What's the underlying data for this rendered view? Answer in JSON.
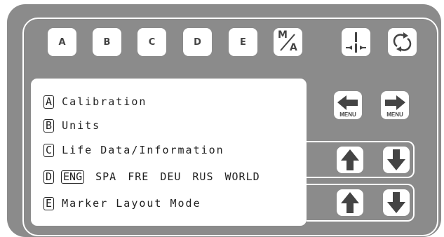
{
  "top_buttons": [
    {
      "label": "A"
    },
    {
      "label": "B"
    },
    {
      "label": "C"
    },
    {
      "label": "D"
    },
    {
      "label": "E"
    }
  ],
  "mode_button": {
    "top": "M",
    "bottom": "A"
  },
  "icons": {
    "center": "center-marker-icon",
    "rotate": "rotate-icon",
    "menu_left": "menu-left-arrow-icon",
    "menu_right": "menu-right-arrow-icon",
    "up": "up-arrow-icon",
    "down": "down-arrow-icon"
  },
  "menu_labels": {
    "left": "MENU",
    "right": "MENU"
  },
  "menu": {
    "items": [
      {
        "key": "A",
        "text": "Calibration"
      },
      {
        "key": "B",
        "text": "Units"
      },
      {
        "key": "C",
        "text": "Life Data/Information"
      },
      {
        "key": "D",
        "languages": [
          "ENG",
          "SPA",
          "FRE",
          "DEU",
          "RUS",
          "WORLD"
        ],
        "selected": "ENG"
      },
      {
        "key": "E",
        "text": "Marker Layout Mode"
      }
    ]
  },
  "colors": {
    "panel": "#8b8b8b",
    "key": "#ffffff",
    "icon": "#444444"
  }
}
